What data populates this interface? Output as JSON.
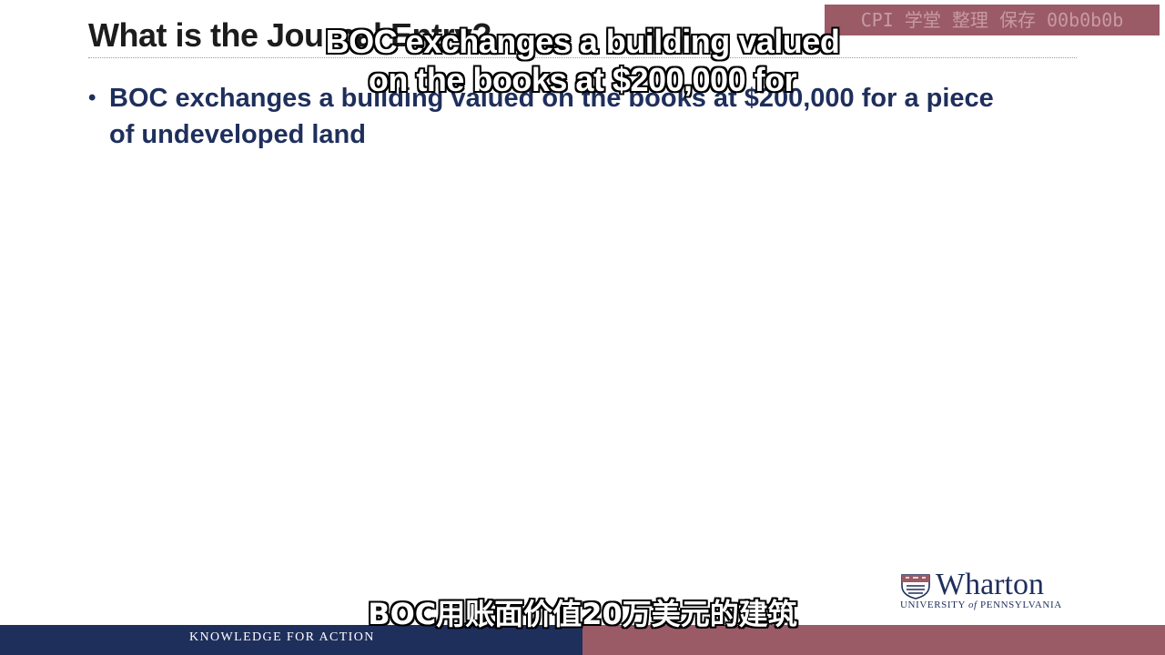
{
  "slide": {
    "title": "What is the Journal Entry?",
    "bullets": [
      "BOC exchanges a building valued on the books at $200,000 for a piece of undeveloped land"
    ]
  },
  "watermark": {
    "text": "CPI 学堂 整理 保存 00b0b0b"
  },
  "captions": {
    "english_line_1": "BOC exchanges a building valued",
    "english_line_2": "on the books at $200,000 for",
    "chinese": "BOC用账面价值20万美元的建筑"
  },
  "branding": {
    "logo_name": "Wharton",
    "logo_sub_1": "UNIVERSITY ",
    "logo_sub_of": "of",
    "logo_sub_2": " PENNSYLVANIA",
    "tagline": "KNOWLEDGE FOR ACTION"
  },
  "colors": {
    "navy": "#1f2f5c",
    "burgundy": "#9a5a66"
  }
}
